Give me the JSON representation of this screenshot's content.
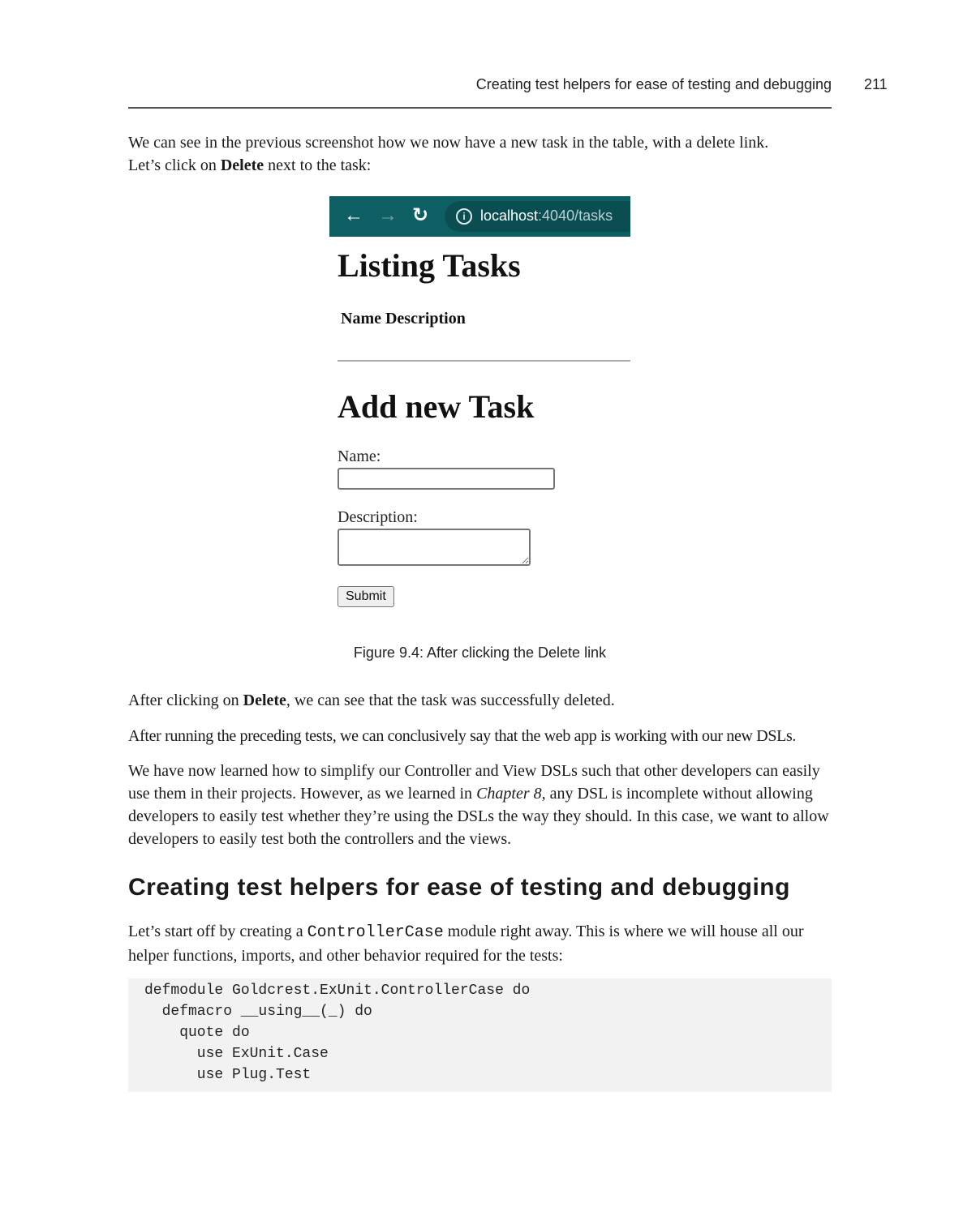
{
  "header": {
    "running_title": "Creating test helpers for ease of testing and debugging",
    "page_number": "211"
  },
  "intro": {
    "line1": "We can see in the previous screenshot how we now have a new task in the table, with a delete link.",
    "line2_prefix": "Let’s click on ",
    "line2_bold": "Delete",
    "line2_suffix": " next to the task:"
  },
  "figure": {
    "browser": {
      "back_icon": "←",
      "forward_icon": "→",
      "reload_icon": "↻",
      "info_icon": "i",
      "url_host": "localhost",
      "url_rest": ":4040/tasks"
    },
    "page": {
      "heading": "Listing Tasks",
      "table_columns": [
        "Name",
        "Description"
      ],
      "table_rows": [],
      "form_heading": "Add new Task",
      "name_label": "Name:",
      "name_value": "",
      "description_label": "Description:",
      "description_value": "",
      "submit_label": "Submit"
    },
    "caption": "Figure 9.4: After clicking the Delete link"
  },
  "body": {
    "p1_prefix": "After clicking on ",
    "p1_bold": "Delete",
    "p1_suffix": ", we can see that the task was successfully deleted.",
    "p2": "After running the preceding tests, we can conclusively say that the web app is working with our new DSLs.",
    "p3_part1": "We have now learned how to simplify our Controller and View DSLs such that other developers can easily use them in their projects. However, as we learned in ",
    "p3_italic": "Chapter 8",
    "p3_part2": ", any DSL is incomplete without allowing developers to easily test whether they’re using the DSLs the way they should. In this case, we want to allow developers to easily test both the controllers and the views."
  },
  "section": {
    "heading": "Creating test helpers for ease of testing and debugging",
    "p_prefix": "Let’s start off by creating a ",
    "p_code": "ControllerCase",
    "p_suffix": " module right away. This is where we will house all our helper functions, imports, and other behavior required for the tests:"
  },
  "code": {
    "lines": [
      "defmodule Goldcrest.ExUnit.ControllerCase do",
      "  defmacro __using__(_) do",
      "    quote do",
      "      use ExUnit.Case",
      "      use Plug.Test"
    ]
  }
}
